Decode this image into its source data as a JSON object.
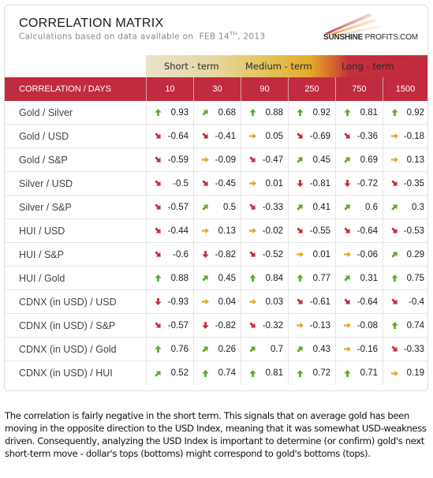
{
  "header": {
    "title": "CORRELATION MATRIX",
    "subtitle_prefix": "Calculations based on data available on",
    "date_day": "FEB 14",
    "date_suffix": "TH",
    "date_year": ", 2013",
    "logo_bold": "SUNSHINE",
    "logo_rest": " PROFITS.COM"
  },
  "terms": [
    "Short - term",
    "Medium - term",
    "Long - term"
  ],
  "columns": {
    "label": "CORRELATION / DAYS",
    "days": [
      "10",
      "30",
      "90",
      "250",
      "750",
      "1500"
    ]
  },
  "colors": {
    "header_red": "#c12b3f",
    "up_green": "#5fa82a",
    "neutral_yellow": "#e8a820",
    "down_red": "#c7283c"
  },
  "rows": [
    {
      "label": "Gold / Silver",
      "values": [
        "0.93",
        "0.68",
        "0.88",
        "0.92",
        "0.81",
        "0.92"
      ],
      "arrows": [
        "arrow-up",
        "arrow-up-right",
        "arrow-up",
        "arrow-up",
        "arrow-up",
        "arrow-up"
      ]
    },
    {
      "label": "Gold / USD",
      "values": [
        "-0.64",
        "-0.41",
        "0.05",
        "-0.69",
        "-0.36",
        "-0.18"
      ],
      "arrows": [
        "arrow-down-right",
        "arrow-down-right",
        "arrow-right",
        "arrow-down-right",
        "arrow-down-right",
        "arrow-right"
      ]
    },
    {
      "label": "Gold / S&P",
      "values": [
        "-0.59",
        "-0.09",
        "-0.47",
        "0.45",
        "0.69",
        "0.13"
      ],
      "arrows": [
        "arrow-down-right",
        "arrow-right",
        "arrow-down-right",
        "arrow-up-right",
        "arrow-up-right",
        "arrow-right"
      ]
    },
    {
      "label": "Silver / USD",
      "values": [
        "-0.5",
        "-0.45",
        "0.01",
        "-0.81",
        "-0.72",
        "-0.35"
      ],
      "arrows": [
        "arrow-down-right",
        "arrow-down-right",
        "arrow-right",
        "arrow-down",
        "arrow-down",
        "arrow-down-right"
      ]
    },
    {
      "label": "Silver / S&P",
      "values": [
        "-0.57",
        "0.5",
        "-0.33",
        "0.41",
        "0.6",
        "0.3"
      ],
      "arrows": [
        "arrow-down-right",
        "arrow-up-right",
        "arrow-down-right",
        "arrow-up-right",
        "arrow-up-right",
        "arrow-up-right"
      ]
    },
    {
      "label": "HUI / USD",
      "values": [
        "-0.44",
        "0.13",
        "-0.02",
        "-0.55",
        "-0.64",
        "-0.53"
      ],
      "arrows": [
        "arrow-down-right",
        "arrow-right",
        "arrow-right",
        "arrow-down-right",
        "arrow-down-right",
        "arrow-down-right"
      ]
    },
    {
      "label": "HUI / S&P",
      "values": [
        "-0.6",
        "-0.82",
        "-0.52",
        "0.01",
        "-0.06",
        "0.29"
      ],
      "arrows": [
        "arrow-down-right",
        "arrow-down",
        "arrow-down-right",
        "arrow-right",
        "arrow-right",
        "arrow-up-right"
      ]
    },
    {
      "label": "HUI / Gold",
      "values": [
        "0.88",
        "0.45",
        "0.84",
        "0.77",
        "0.31",
        "0.75"
      ],
      "arrows": [
        "arrow-up",
        "arrow-up-right",
        "arrow-up",
        "arrow-up",
        "arrow-up-right",
        "arrow-up"
      ]
    },
    {
      "label": "CDNX (in USD) / USD",
      "values": [
        "-0.93",
        "0.04",
        "0.03",
        "-0.61",
        "-0.64",
        "-0.4"
      ],
      "arrows": [
        "arrow-down",
        "arrow-right",
        "arrow-right",
        "arrow-down-right",
        "arrow-down-right",
        "arrow-down-right"
      ]
    },
    {
      "label": "CDNX (in USD) / S&P",
      "values": [
        "-0.57",
        "-0.82",
        "-0.32",
        "-0.13",
        "-0.08",
        "0.74"
      ],
      "arrows": [
        "arrow-down-right",
        "arrow-down",
        "arrow-down-right",
        "arrow-right",
        "arrow-right",
        "arrow-up"
      ]
    },
    {
      "label": "CDNX (in USD) / Gold",
      "values": [
        "0.76",
        "0.26",
        "0.7",
        "0.43",
        "-0.16",
        "-0.33"
      ],
      "arrows": [
        "arrow-up",
        "arrow-up-right",
        "arrow-up-right",
        "arrow-up-right",
        "arrow-right",
        "arrow-down-right"
      ]
    },
    {
      "label": "CDNX (in USD) / HUI",
      "values": [
        "0.52",
        "0.74",
        "0.81",
        "0.72",
        "0.71",
        "0.19"
      ],
      "arrows": [
        "arrow-up-right",
        "arrow-up",
        "arrow-up",
        "arrow-up",
        "arrow-up",
        "arrow-right"
      ]
    }
  ],
  "footer": {
    "text": "The correlation is fairly negative in the short term. This signals that on average gold has been moving in the opposite direction to the USD Index, meaning that it was somewhat USD-weakness driven. Consequently, analyzing the USD Index is important to determine (or confirm) gold's next short-term move - dollar's tops (bottoms) might correspond to gold's bottoms (tops)."
  }
}
